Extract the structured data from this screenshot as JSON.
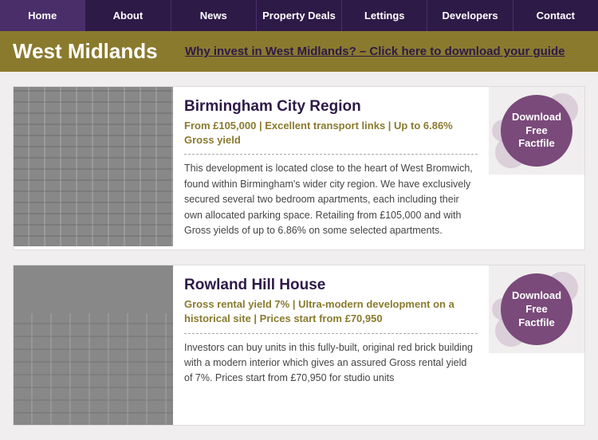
{
  "nav": {
    "items": [
      {
        "label": "Home",
        "id": "home"
      },
      {
        "label": "About",
        "id": "about"
      },
      {
        "label": "News",
        "id": "news"
      },
      {
        "label": "Property Deals",
        "id": "property-deals"
      },
      {
        "label": "Lettings",
        "id": "lettings"
      },
      {
        "label": "Developers",
        "id": "developers"
      },
      {
        "label": "Contact",
        "id": "contact"
      }
    ]
  },
  "header": {
    "region": "West Midlands",
    "invest_text": "Why invest in West Midlands? – Click here to download your guide"
  },
  "properties": [
    {
      "title": "Birmingham City Region",
      "subtitle": "From £105,000 | Excellent transport links | Up to 6.86% Gross yield",
      "description": "This development is located close to the heart of West Bromwich, found within Birmingham's wider city region. We have exclusively secured several two bedroom apartments, each including their own allocated parking space. Retailing from £105,000 and with Gross yields of up to 6.86% on some selected apartments.",
      "download_label": "Download\nFree\nFactfile"
    },
    {
      "title": "Rowland Hill House",
      "subtitle": "Gross rental yield 7% | Ultra-modern development on a historical site | Prices start from £70,950",
      "description": "Investors can buy units in this fully-built, original red brick building with a modern interior which gives an assured Gross rental yield of 7%. Prices start from £70,950 for studio units",
      "download_label": "Download\nFree\nFactfile"
    }
  ],
  "download_button": {
    "line1": "Download",
    "line2": "Free",
    "line3": "Factfile"
  }
}
